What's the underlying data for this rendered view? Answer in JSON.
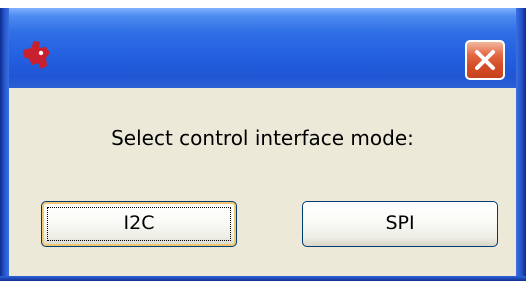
{
  "window": {
    "title_icon": "texas-instruments-logo",
    "close_icon": "close-icon",
    "prompt": "Select control interface mode:"
  },
  "buttons": {
    "i2c_label": "I2C",
    "spi_label": "SPI"
  },
  "colors": {
    "titlebar": "#2460e0",
    "client_bg": "#ece9d8",
    "close_button": "#d54d28",
    "logo_red": "#c8202c",
    "button_border": "#003c74"
  }
}
